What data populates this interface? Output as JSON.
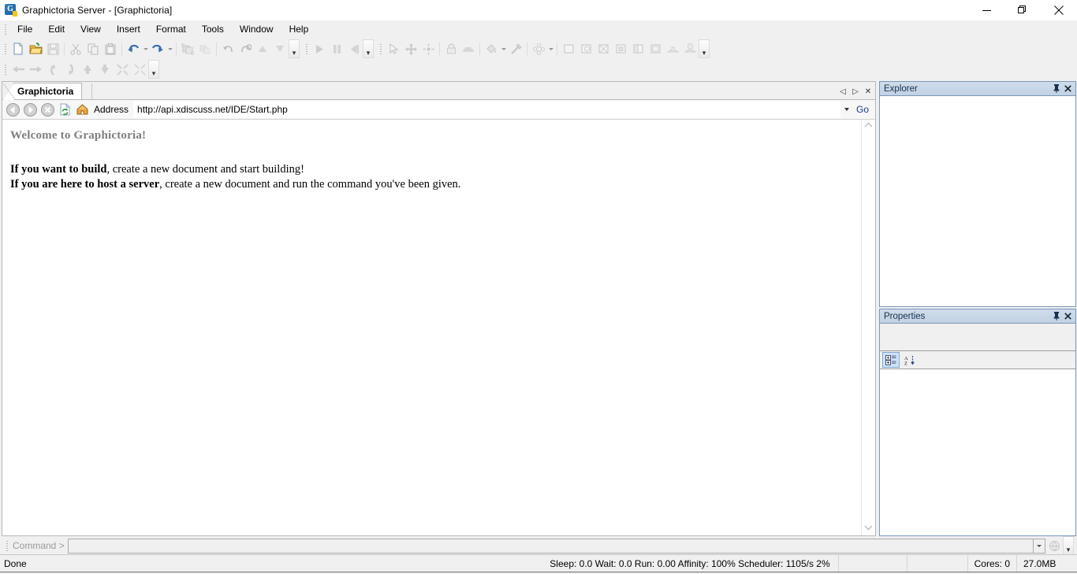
{
  "window": {
    "title": "Graphictoria Server - [Graphictoria]",
    "icon": "graphictoria-logo-icon",
    "controls": {
      "minimize": "minimize-button",
      "restore": "restore-button",
      "close": "close-button"
    }
  },
  "menubar": {
    "items": [
      {
        "label": "File"
      },
      {
        "label": "Edit"
      },
      {
        "label": "View"
      },
      {
        "label": "Insert"
      },
      {
        "label": "Format"
      },
      {
        "label": "Tools"
      },
      {
        "label": "Window"
      },
      {
        "label": "Help"
      }
    ]
  },
  "toolbars": {
    "row1_group1": [
      {
        "name": "new-document-icon",
        "enabled": true
      },
      {
        "name": "open-folder-icon",
        "enabled": true
      },
      {
        "name": "save-icon",
        "enabled": false
      },
      {
        "sep": true
      },
      {
        "name": "cut-icon",
        "enabled": false
      },
      {
        "name": "copy-icon",
        "enabled": false
      },
      {
        "name": "paste-icon",
        "enabled": false
      },
      {
        "sep": true
      },
      {
        "name": "undo-icon",
        "enabled": true,
        "dropdown": true
      },
      {
        "name": "redo-icon",
        "enabled": true,
        "dropdown": true
      },
      {
        "sep": true
      },
      {
        "name": "group-icon",
        "enabled": false
      },
      {
        "name": "ungroup-icon",
        "enabled": false
      },
      {
        "sep": true
      },
      {
        "name": "rotate-left-icon",
        "enabled": false
      },
      {
        "name": "rotate-right-icon",
        "enabled": false
      },
      {
        "name": "move-up-icon",
        "enabled": false
      },
      {
        "name": "move-down-icon",
        "enabled": false
      }
    ],
    "row1_group2": [
      {
        "name": "play-icon",
        "enabled": false
      },
      {
        "name": "pause-icon",
        "enabled": false
      },
      {
        "name": "step-icon",
        "enabled": false
      }
    ],
    "row1_group3": [
      {
        "name": "select-arrow-icon",
        "enabled": false
      },
      {
        "name": "move-tool-icon",
        "enabled": false
      },
      {
        "name": "scale-tool-icon",
        "enabled": false
      },
      {
        "sep": true
      },
      {
        "name": "lock-icon",
        "enabled": false
      },
      {
        "name": "surface-icon",
        "enabled": false
      },
      {
        "sep": true
      },
      {
        "name": "paint-bucket-icon",
        "enabled": false,
        "dropdown": true
      },
      {
        "name": "color-picker-icon",
        "enabled": false
      },
      {
        "sep": true
      },
      {
        "name": "material-icon",
        "enabled": false,
        "dropdown": true
      },
      {
        "sep": true
      },
      {
        "name": "part-block-icon",
        "enabled": false
      },
      {
        "name": "part-cylinder-icon",
        "enabled": false
      },
      {
        "name": "part-wedge-icon",
        "enabled": false
      },
      {
        "name": "part-corner-icon",
        "enabled": false
      },
      {
        "name": "part-sphere-icon",
        "enabled": false
      },
      {
        "name": "part-truss-icon",
        "enabled": false
      },
      {
        "name": "spawn-icon",
        "enabled": false
      },
      {
        "name": "tree-icon",
        "enabled": false
      }
    ],
    "row2": [
      {
        "name": "nav-left-icon",
        "enabled": false
      },
      {
        "name": "nav-right-icon",
        "enabled": false
      },
      {
        "name": "nav-forward-icon",
        "enabled": false
      },
      {
        "name": "nav-back-icon",
        "enabled": false
      },
      {
        "name": "nav-up-icon",
        "enabled": false
      },
      {
        "name": "nav-down-icon",
        "enabled": false
      },
      {
        "name": "collapse-icon",
        "enabled": false
      },
      {
        "name": "expand-icon",
        "enabled": false
      }
    ],
    "overflow_label": "▾"
  },
  "document": {
    "tab": {
      "label": "Graphictoria"
    },
    "tabnav": {
      "prev": "◁",
      "next": "▷",
      "close": "✕"
    },
    "address": {
      "label": "Address",
      "url": "http://api.xdiscuss.net/IDE/Start.php",
      "placeholder": "",
      "go_label": "Go",
      "nav": [
        "back-icon",
        "forward-icon",
        "stop-icon",
        "refresh-icon",
        "home-icon"
      ]
    },
    "page": {
      "heading": "Welcome to Graphictoria!",
      "line1_bold": "If you want to build",
      "line1_rest": ", create a new document and start building!",
      "line2_bold": "If you are here to host a server",
      "line2_rest": ", create a new document and run the command you've been given."
    },
    "scrollbar": {
      "up": "▲",
      "down": "▼"
    }
  },
  "panels": {
    "explorer": {
      "title": "Explorer",
      "pin": "pin-icon",
      "close": "close-icon",
      "items": []
    },
    "properties": {
      "title": "Properties",
      "pin": "pin-icon",
      "close": "close-icon",
      "toolbar": [
        {
          "name": "categorized-view-button",
          "selected": true
        },
        {
          "name": "alphabetical-sort-button",
          "selected": false
        }
      ],
      "rows": []
    }
  },
  "commandbar": {
    "label": "Command >",
    "value": "",
    "placeholder": "",
    "icon": "run-command-icon",
    "overflow": "▾"
  },
  "statusbar": {
    "status": "Done",
    "stats": "Sleep: 0.0 Wait: 0.0 Run: 0.00 Affinity: 100% Scheduler: 1105/s 2%",
    "cores": "Cores: 0",
    "memory": "27.0MB"
  },
  "colors": {
    "panel_header": "#c2d2e4",
    "panel_border": "#7a96b8",
    "toolbar_bg": "#f0f0f0",
    "heading_text": "#7f7f7f",
    "selection": "#cde2f7"
  }
}
